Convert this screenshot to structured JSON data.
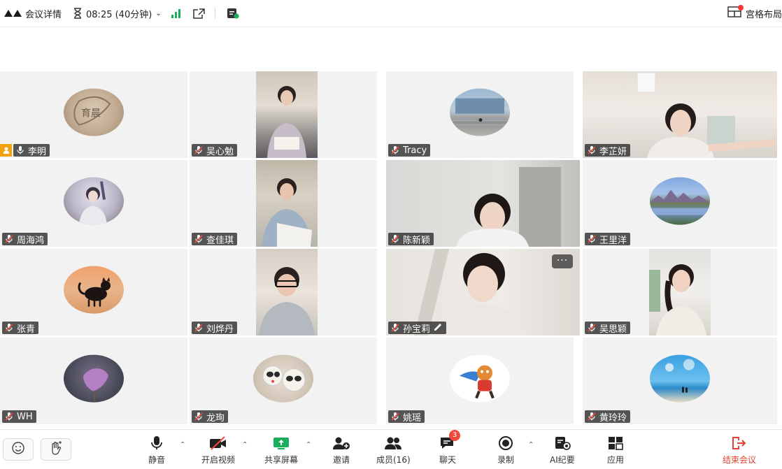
{
  "topbar": {
    "meeting_details": "会议详情",
    "duration": "08:25 (40分钟)",
    "layout_label": "宫格布局"
  },
  "participants": [
    {
      "name": "李明",
      "host": true
    },
    {
      "name": "吴心勉"
    },
    {
      "name": "Tracy"
    },
    {
      "name": "李芷妍"
    },
    {
      "name": "周海鸿"
    },
    {
      "name": "查佳琪"
    },
    {
      "name": "陈新颖"
    },
    {
      "name": "王里洋"
    },
    {
      "name": "张青"
    },
    {
      "name": "刘烨丹"
    },
    {
      "name": "孙宝莉"
    },
    {
      "name": "吴思颖"
    },
    {
      "name": "WH"
    },
    {
      "name": "龙珣"
    },
    {
      "name": "姚瑶"
    },
    {
      "name": "黄玲玲"
    }
  ],
  "tile_more_label": "···",
  "toolbar": {
    "mute": "静音",
    "video": "开启视频",
    "share": "共享屏幕",
    "invite": "邀请",
    "members": "成员(16)",
    "chat": "聊天",
    "chat_badge": "3",
    "record": "录制",
    "ai_notes": "AI纪要",
    "apps": "应用",
    "end": "结束会议"
  },
  "colors": {
    "accent_green": "#1aad5b",
    "end_red": "#e0432f",
    "badge_red": "#f04a3c",
    "host_orange": "#f2a20c"
  }
}
